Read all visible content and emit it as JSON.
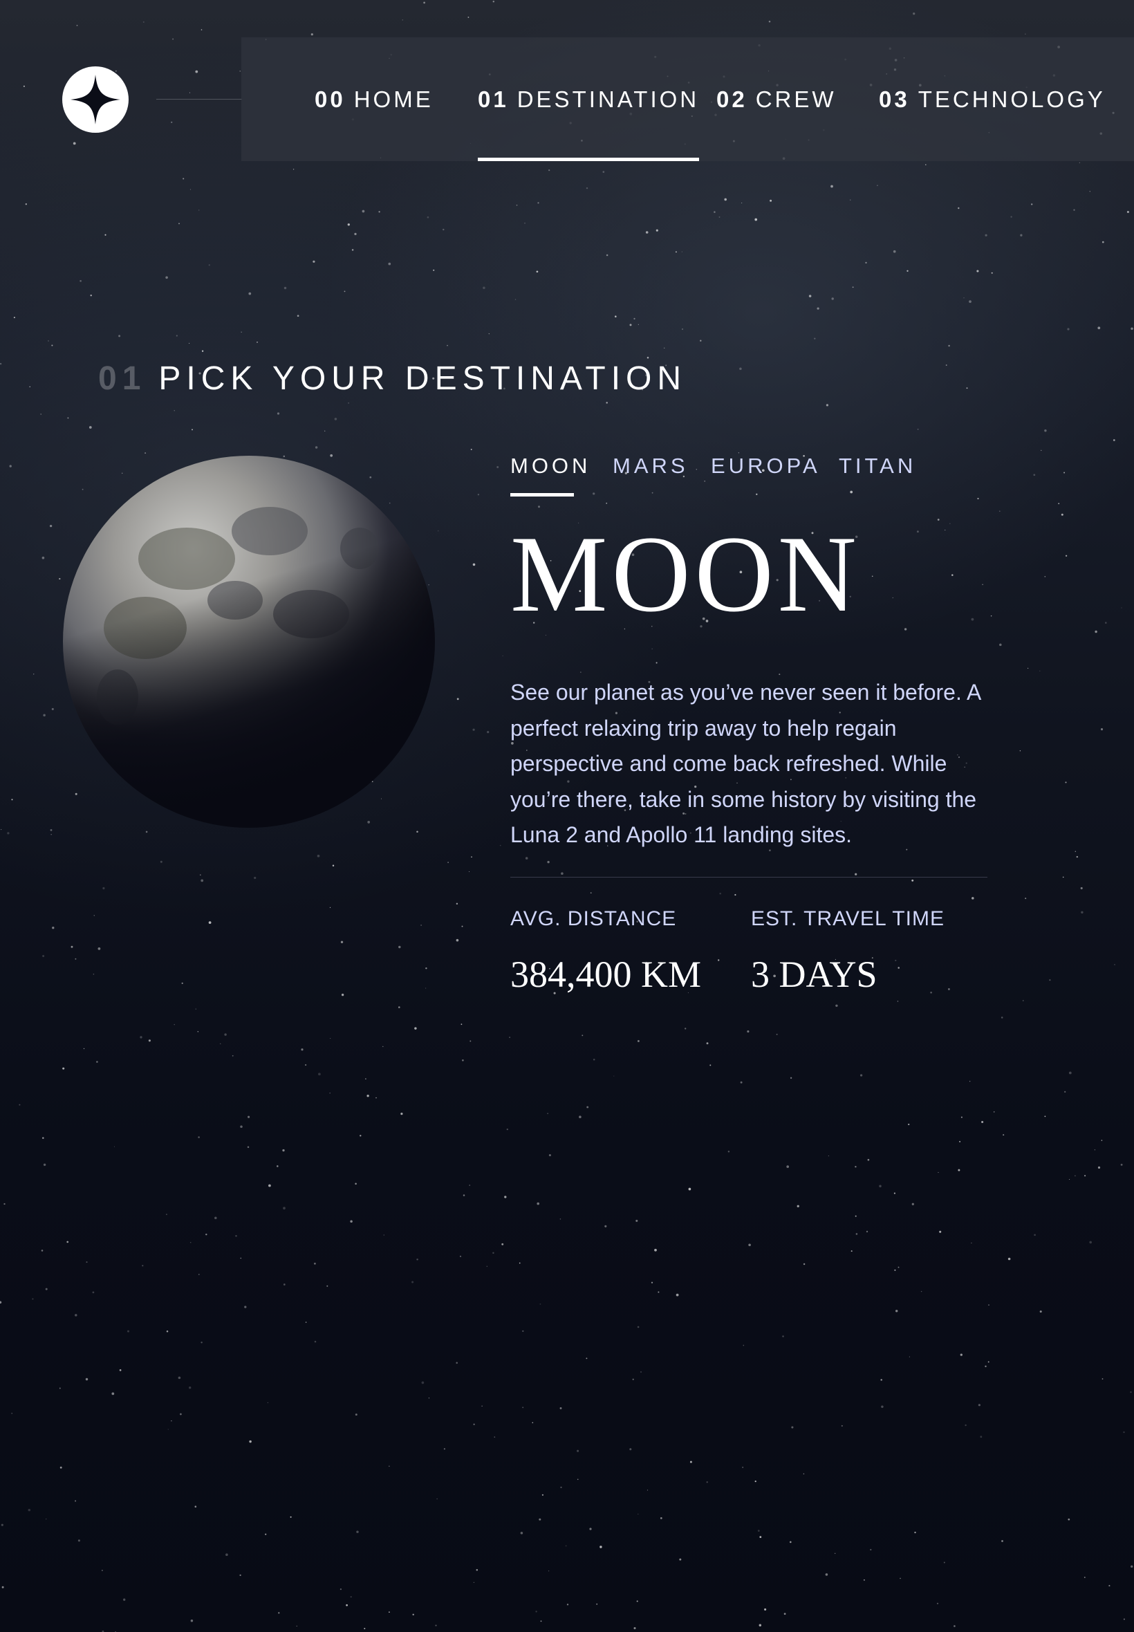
{
  "nav": {
    "items": [
      {
        "number": "00",
        "label": "HOME",
        "active": false
      },
      {
        "number": "01",
        "label": "DESTINATION",
        "active": true
      },
      {
        "number": "02",
        "label": "CREW",
        "active": false
      },
      {
        "number": "03",
        "label": "TECHNOLOGY",
        "active": false
      }
    ]
  },
  "heading": {
    "number": "01",
    "title": "PICK YOUR DESTINATION"
  },
  "tabs": [
    {
      "label": "MOON",
      "active": true
    },
    {
      "label": "MARS",
      "active": false
    },
    {
      "label": "EUROPA",
      "active": false
    },
    {
      "label": "TITAN",
      "active": false
    }
  ],
  "destination": {
    "name": "MOON",
    "description": "See our planet as you’ve never seen it before. A perfect relaxing trip away to help regain perspective and come back refreshed. While you’re there, take in some history by visiting the Luna 2 and Apollo 11 landing sites.",
    "distance_label": "AVG. DISTANCE",
    "distance_value": "384,400 KM",
    "travel_label": "EST. TRAVEL TIME",
    "travel_value": "3 DAYS"
  },
  "colors": {
    "background": "#0b0e19",
    "accent": "#d0d6f9",
    "white": "#ffffff"
  },
  "icons": {
    "logo": "four-point-star-logo-icon"
  }
}
